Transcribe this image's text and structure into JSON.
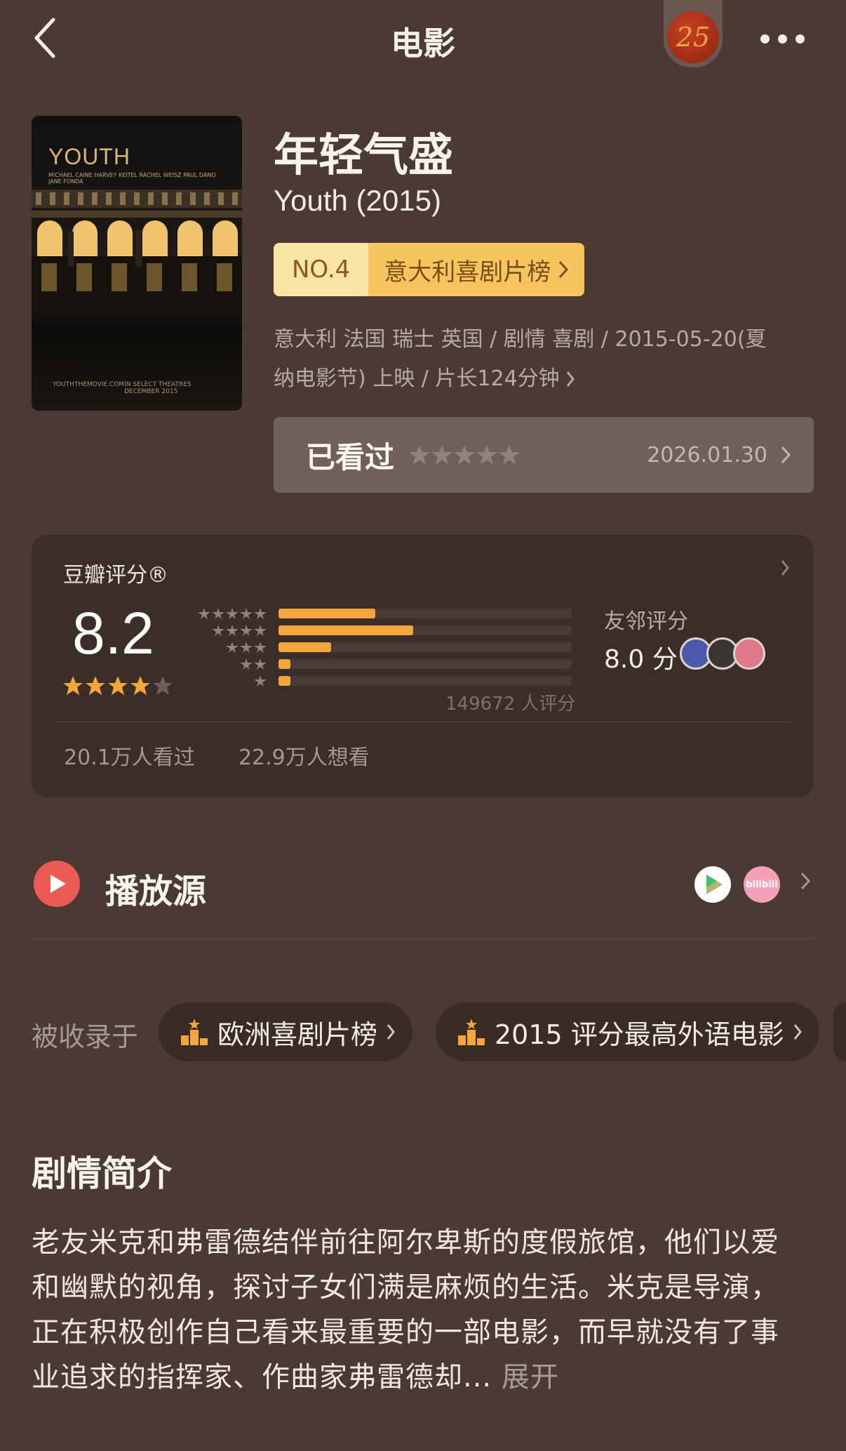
{
  "header": {
    "title": "电影",
    "badge_text": "25"
  },
  "poster": {
    "title": "YOUTH",
    "cast": "MICHAEL CAINE   HARVEY KEITEL   RACHEL WEISZ   PAUL DANO   JANE FONDA",
    "footer_left": "YOUTHTHEMOVIE.COM",
    "footer_right": "IN SELECT THEATRES DECEMBER 2015"
  },
  "movie": {
    "title": "年轻气盛",
    "subtitle": "Youth (2015)",
    "rank_no": "NO.4",
    "rank_list": "意大利喜剧片榜",
    "meta_line1": "意大利 法国 瑞士 英国 / 剧情 喜剧 / 2015-05-20(夏",
    "meta_line2": "纳电影节) 上映 / 片长124分钟"
  },
  "watched": {
    "label": "已看过",
    "stars": 0,
    "date": "2026.01.30"
  },
  "rating": {
    "title": "豆瓣评分®",
    "score": "8.2",
    "stars": 4,
    "distribution": [
      {
        "stars": 5,
        "percent": 33
      },
      {
        "stars": 4,
        "percent": 46
      },
      {
        "stars": 3,
        "percent": 18
      },
      {
        "stars": 2,
        "percent": 4
      },
      {
        "stars": 1,
        "percent": 4
      }
    ],
    "count_text": "149672 人评分",
    "friend_label": "友邻评分",
    "friend_score": "8.0 分",
    "watched_text": "20.1万人看过",
    "wish_text": "22.9万人想看"
  },
  "play_source": {
    "label": "播放源",
    "bili_text": "bilibili"
  },
  "collections": {
    "label": "被收录于",
    "items": [
      "欧洲喜剧片榜",
      "2015 评分最高外语电影"
    ]
  },
  "synopsis": {
    "title": "剧情简介",
    "text": "老友米克和弗雷德结伴前往阿尔卑斯的度假旅馆，他们以爱和幽默的视角，探讨子女们满是麻烦的生活。米克是导演，正在积极创作自己看来最重要的一部电影，而早就没有了事业追求的指挥家、作曲家弗雷德却...",
    "more": "展开"
  },
  "colors": {
    "background": "#4b3a33",
    "card": "#3b2d27",
    "accent_orange": "#f3a63b",
    "play_red": "#eb5a55"
  }
}
